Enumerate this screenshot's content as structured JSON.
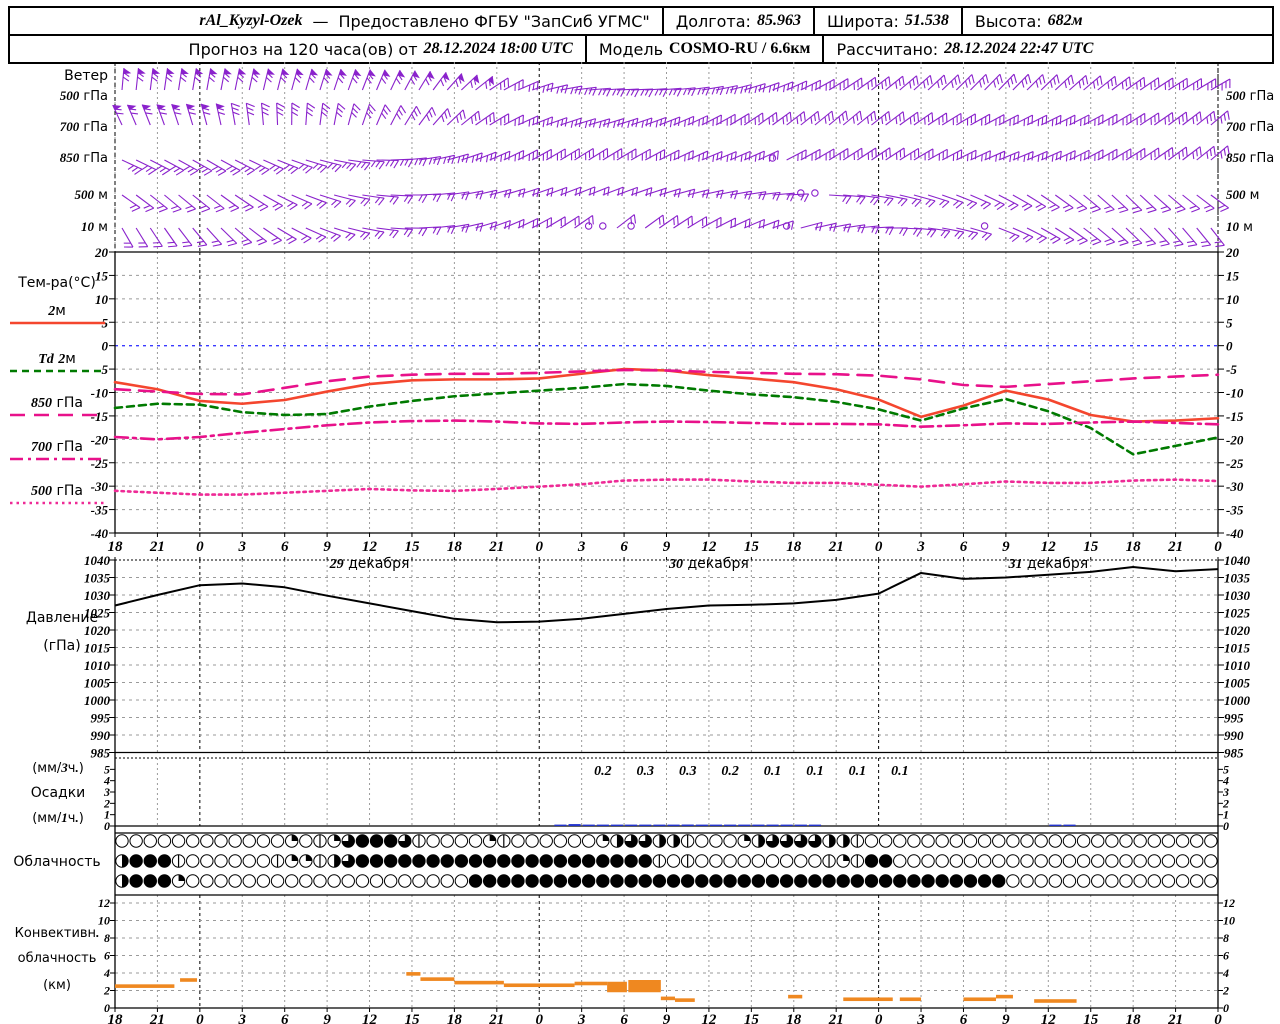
{
  "header": {
    "line1": {
      "station": "rAl_Kyzyl-Ozek",
      "dash": "—",
      "provider": "Предоставлено ФГБУ \"ЗапСиб УГМС\"",
      "lon_label": "Долгота:",
      "lon": "85.963",
      "lat_label": "Широта:",
      "lat": "51.538",
      "alt_label": "Высота:",
      "alt": "682м"
    },
    "line2": {
      "forecast_label": "Прогноз на 120 часа(ов) от",
      "init_time": "28.12.2024 18:00 UTC",
      "model_label": "Модель",
      "model": "COSMO-RU / 6.6км",
      "calc_label": "Рассчитано:",
      "calc_time": "28.12.2024 22:47 UTC"
    }
  },
  "chart_data": {
    "type": "line",
    "x_axis": {
      "hours_total": 78,
      "hour_labels": [
        "18",
        "21",
        "0",
        "3",
        "6",
        "9",
        "12",
        "15",
        "18",
        "21",
        "0",
        "3",
        "6",
        "9",
        "12",
        "15",
        "18",
        "21",
        "0",
        "3",
        "6",
        "9",
        "12",
        "15",
        "18",
        "21",
        "0"
      ],
      "day_boundary_hours": [
        6,
        30,
        54,
        78
      ],
      "date_labels": [
        {
          "num": "29",
          "word": " декабря",
          "center_hour": 18
        },
        {
          "num": "30",
          "word": " декабря",
          "center_hour": 42
        },
        {
          "num": "31",
          "word": " декабря",
          "center_hour": 66
        }
      ]
    },
    "wind": {
      "title": "Ветер",
      "color": "#8a22cc",
      "levels": [
        {
          "label": "500 гПа",
          "feathers": 3,
          "flag_until_hour": 26,
          "angles": [
            5,
            8,
            10,
            12,
            15,
            18,
            22,
            30,
            45,
            60,
            75,
            85,
            88,
            85,
            80,
            72,
            65,
            58,
            52,
            48,
            45,
            44,
            46,
            50,
            55,
            58,
            60
          ]
        },
        {
          "label": "700 гПа",
          "feathers": 3,
          "flag_until_hour": 8,
          "angles": [
            -25,
            -20,
            -15,
            -8,
            0,
            10,
            22,
            35,
            50,
            62,
            70,
            74,
            72,
            68,
            62,
            56,
            52,
            50,
            52,
            56,
            60,
            63,
            64,
            62,
            58,
            54,
            50
          ]
        },
        {
          "label": "850 гПа",
          "feathers": 3,
          "flag_until_hour": 0,
          "angles": [
            115,
            118,
            120,
            116,
            110,
            102,
            92,
            82,
            72,
            65,
            60,
            58,
            60,
            64,
            68,
            66,
            62,
            58,
            56,
            60,
            64,
            68,
            66,
            62,
            58,
            54,
            50
          ]
        },
        {
          "label": "500 м",
          "feathers": 2,
          "flag_until_hour": 0,
          "angles": [
            125,
            130,
            128,
            122,
            114,
            105,
            96,
            88,
            80,
            74,
            70,
            68,
            70,
            74,
            78,
            82,
            88,
            94,
            100,
            106,
            112,
            118,
            124,
            130,
            134,
            130,
            126
          ]
        },
        {
          "label": "10 м",
          "feathers": 2,
          "flag_until_hour": 0,
          "angles": [
            150,
            145,
            138,
            128,
            118,
            108,
            98,
            88,
            78,
            68,
            60,
            54,
            52,
            56,
            62,
            68,
            74,
            80,
            88,
            96,
            104,
            112,
            120,
            128,
            134,
            138,
            142
          ]
        }
      ],
      "calm": [
        {
          "level": 2,
          "h": 46
        },
        {
          "level": 3,
          "h": 48
        },
        {
          "level": 3,
          "h": 49
        },
        {
          "level": 4,
          "h": 33
        },
        {
          "level": 4,
          "h": 34
        },
        {
          "level": 4,
          "h": 36
        },
        {
          "level": 4,
          "h": 47
        },
        {
          "level": 4,
          "h": 61
        }
      ]
    },
    "temperature": {
      "title": "Тем-ра(°C)",
      "ylim": [
        -40,
        20
      ],
      "ytick_step": 5,
      "zero_line_color": "#3a3aff",
      "series": [
        {
          "label": "2м",
          "color": "#f4462e",
          "dash": "solid",
          "values": [
            -7.8,
            -9.3,
            -11.8,
            -12.4,
            -11.6,
            -9.8,
            -8.2,
            -7.4,
            -7.2,
            -7.2,
            -7,
            -6,
            -5,
            -5.3,
            -6.3,
            -7,
            -7.8,
            -9.3,
            -11.5,
            -15.2,
            -12.8,
            -9.6,
            -11.5,
            -14.8,
            -16.2,
            -16,
            -15.5
          ]
        },
        {
          "label": "Td 2м",
          "color": "#007a00",
          "dash": "dashed",
          "values": [
            -13.3,
            -12.4,
            -12.6,
            -14.2,
            -14.8,
            -14.6,
            -13,
            -11.8,
            -10.8,
            -10.2,
            -9.6,
            -9,
            -8.2,
            -8.6,
            -9.6,
            -10.4,
            -11,
            -12,
            -13.6,
            -16,
            -13.4,
            -11.4,
            -14,
            -17.6,
            -23.2,
            -21.4,
            -19.6
          ]
        },
        {
          "label": "850 гПа",
          "color": "#e8118a",
          "dash": "longdash",
          "values": [
            -9.3,
            -9.8,
            -10.3,
            -10.4,
            -9,
            -7.6,
            -6.6,
            -6.2,
            -6,
            -6,
            -5.8,
            -5.5,
            -5.2,
            -5.3,
            -5.6,
            -5.8,
            -6,
            -6.1,
            -6.4,
            -7.2,
            -8.4,
            -8.8,
            -8.2,
            -7.6,
            -7,
            -6.6,
            -6.2
          ]
        },
        {
          "label": "700 гПа",
          "color": "#e8118a",
          "dash": "dashdot",
          "values": [
            -19.5,
            -20,
            -19.5,
            -18.6,
            -17.8,
            -17,
            -16.4,
            -16.1,
            -16,
            -16.2,
            -16.6,
            -16.7,
            -16.4,
            -16.2,
            -16.3,
            -16.5,
            -16.7,
            -16.7,
            -16.8,
            -17.3,
            -17,
            -16.6,
            -16.7,
            -16.4,
            -16.2,
            -16.5,
            -16.8
          ]
        },
        {
          "label": "500 гПа",
          "color": "#ee2a96",
          "dash": "dotted",
          "values": [
            -31,
            -31.4,
            -31.8,
            -31.8,
            -31.4,
            -31,
            -30.6,
            -30.9,
            -31,
            -30.6,
            -30.1,
            -29.6,
            -28.8,
            -28.6,
            -28.6,
            -29,
            -29.3,
            -29.3,
            -29.7,
            -30.1,
            -29.6,
            -29,
            -29.3,
            -29.3,
            -28.8,
            -28.6,
            -28.9
          ]
        }
      ]
    },
    "pressure": {
      "label_1": "Давление",
      "label_2": "(гПа)",
      "ylim": [
        985,
        1040
      ],
      "ytick_step": 5,
      "values": [
        1027,
        1030,
        1032.8,
        1033.3,
        1032.2,
        1029.8,
        1027.6,
        1025.4,
        1023.2,
        1022.2,
        1022.4,
        1023.2,
        1024.6,
        1026,
        1027,
        1027.2,
        1027.6,
        1028.6,
        1030.4,
        1036.3,
        1034.6,
        1035,
        1035.8,
        1036.6,
        1038,
        1036.8,
        1037.4
      ]
    },
    "precipitation": {
      "label_1": "(мм/3ч.)",
      "label_2": "Осадки",
      "label_3": "(мм/1ч.)",
      "ylim": [
        0,
        5
      ],
      "bar_color": "#2233cc",
      "amounts_3h": [
        {
          "start_hour": 33,
          "value": "0.2"
        },
        {
          "start_hour": 36,
          "value": "0.3"
        },
        {
          "start_hour": 39,
          "value": "0.3"
        },
        {
          "start_hour": 42,
          "value": "0.2"
        },
        {
          "start_hour": 45,
          "value": "0.1"
        },
        {
          "start_hour": 48,
          "value": "0.1"
        },
        {
          "start_hour": 51,
          "value": "0.1"
        },
        {
          "start_hour": 54,
          "value": "0.1"
        }
      ],
      "hourly_bars": [
        {
          "h": 31,
          "v": 0.08
        },
        {
          "h": 32,
          "v": 0.17
        },
        {
          "h": 33,
          "v": 0.1
        },
        {
          "h": 34,
          "v": 0.1
        },
        {
          "h": 35,
          "v": 0.09
        },
        {
          "h": 36,
          "v": 0.08
        },
        {
          "h": 37,
          "v": 0.1
        },
        {
          "h": 38,
          "v": 0.08
        },
        {
          "h": 39,
          "v": 0.09
        },
        {
          "h": 40,
          "v": 0.13
        },
        {
          "h": 41,
          "v": 0.1
        },
        {
          "h": 42,
          "v": 0.08
        },
        {
          "h": 43,
          "v": 0.07
        },
        {
          "h": 44,
          "v": 0.05
        },
        {
          "h": 45,
          "v": 0.06
        },
        {
          "h": 46,
          "v": 0.08
        },
        {
          "h": 47,
          "v": 0.08
        },
        {
          "h": 48,
          "v": 0.07
        },
        {
          "h": 49,
          "v": 0.05
        },
        {
          "h": 66,
          "v": 0.05
        },
        {
          "h": 67,
          "v": 0.04
        }
      ]
    },
    "cloudiness": {
      "label": "Облачность",
      "rows": [
        [
          0,
          0,
          0,
          0,
          0,
          0,
          0,
          0,
          0,
          0,
          0,
          0,
          2,
          0,
          1,
          2,
          6,
          8,
          8,
          8,
          6,
          1,
          0,
          0,
          0,
          0,
          2,
          1,
          0,
          0,
          0,
          0,
          0,
          0,
          2,
          4,
          6,
          6,
          4,
          4,
          1,
          0,
          0,
          0,
          2,
          4,
          6,
          6,
          6,
          6,
          4,
          4,
          1,
          0,
          0,
          0,
          0,
          0,
          0,
          0,
          0,
          0,
          0,
          0,
          0,
          0,
          0,
          0,
          0,
          0,
          0,
          0,
          0,
          0,
          0,
          0,
          0,
          0
        ],
        [
          4,
          8,
          8,
          8,
          1,
          0,
          0,
          0,
          0,
          0,
          0,
          1,
          2,
          2,
          1,
          4,
          6,
          8,
          8,
          8,
          8,
          8,
          8,
          8,
          8,
          8,
          8,
          8,
          8,
          8,
          8,
          8,
          8,
          8,
          8,
          8,
          8,
          8,
          1,
          0,
          1,
          0,
          0,
          0,
          0,
          0,
          0,
          0,
          0,
          0,
          1,
          2,
          1,
          8,
          8,
          0,
          0,
          0,
          0,
          0,
          0,
          0,
          0,
          0,
          0,
          0,
          0,
          0,
          0,
          0,
          0,
          0,
          0,
          0,
          0,
          0,
          0,
          0
        ],
        [
          4,
          8,
          8,
          8,
          2,
          0,
          0,
          0,
          0,
          0,
          0,
          0,
          0,
          0,
          0,
          0,
          0,
          0,
          0,
          0,
          0,
          0,
          0,
          0,
          0,
          8,
          8,
          8,
          8,
          8,
          8,
          8,
          8,
          8,
          8,
          8,
          8,
          8,
          8,
          8,
          8,
          8,
          8,
          8,
          8,
          8,
          8,
          8,
          8,
          8,
          8,
          8,
          8,
          8,
          8,
          8,
          8,
          8,
          8,
          8,
          8,
          8,
          8,
          0,
          0,
          0,
          0,
          0,
          0,
          0,
          0,
          0,
          0,
          0,
          0,
          0,
          0,
          0
        ]
      ]
    },
    "convective": {
      "label_1": "Конвективн.",
      "label_2": "облачность",
      "label_3": "(км)",
      "ylim": [
        0,
        12
      ],
      "ytick_step": 2,
      "color": "#ef8820",
      "marks": [
        {
          "h0": 0,
          "h1": 4.2,
          "km": 2.5
        },
        {
          "h0": 4.6,
          "h1": 5.8,
          "km": 3.2
        },
        {
          "h0": 20.6,
          "h1": 21.6,
          "km": 3.9
        },
        {
          "h0": 21.6,
          "h1": 24,
          "km": 3.3
        },
        {
          "h0": 24,
          "h1": 27.5,
          "km": 2.9
        },
        {
          "h0": 27.5,
          "h1": 32.5,
          "km": 2.6
        },
        {
          "h0": 32.5,
          "h1": 34.8,
          "km": 2.8
        },
        {
          "h0": 38.6,
          "h1": 39.6,
          "km": 1.1
        },
        {
          "h0": 39.6,
          "h1": 41,
          "km": 0.9
        },
        {
          "h0": 47.6,
          "h1": 48.6,
          "km": 1.3
        },
        {
          "h0": 51.5,
          "h1": 55,
          "km": 1.0
        },
        {
          "h0": 55.5,
          "h1": 57,
          "km": 1.0
        },
        {
          "h0": 60,
          "h1": 62.3,
          "km": 1.0
        },
        {
          "h0": 62.3,
          "h1": 63.5,
          "km": 1.3
        },
        {
          "h0": 65,
          "h1": 68,
          "km": 0.8
        }
      ],
      "blocks": [
        {
          "h0": 34.8,
          "h1": 36.2,
          "k0": 1.8,
          "k1": 3.0
        },
        {
          "h0": 36.3,
          "h1": 38.6,
          "k0": 1.8,
          "k1": 3.2
        }
      ]
    }
  }
}
